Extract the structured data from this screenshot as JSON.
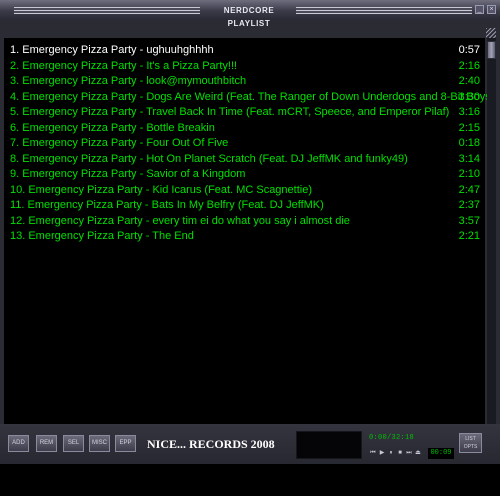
{
  "window": {
    "title": "NERDCORE PLAYLIST",
    "minimize_glyph": "_",
    "close_glyph": "×"
  },
  "tracks": [
    {
      "label": "1. Emergency Pizza Party - ughuuhghhhh",
      "duration": "0:57",
      "current": true
    },
    {
      "label": "2. Emergency Pizza Party - It's a Pizza Party!!!",
      "duration": "2:16",
      "current": false
    },
    {
      "label": "3. Emergency Pizza Party - look@mymouthbitch",
      "duration": "2:40",
      "current": false
    },
    {
      "label": "4. Emergency Pizza Party - Dogs Are Weird (Feat. The Ranger of Down Underdogs and 8-Bit Boys)",
      "duration": "3:30",
      "current": false
    },
    {
      "label": "5. Emergency Pizza Party - Travel Back In Time (Feat. mCRT, Speece, and Emperor Pilaf)",
      "duration": "3:16",
      "current": false
    },
    {
      "label": "6. Emergency Pizza Party - Bottle Breakin",
      "duration": "2:15",
      "current": false
    },
    {
      "label": "7. Emergency Pizza Party - Four Out Of Five",
      "duration": "0:18",
      "current": false
    },
    {
      "label": "8. Emergency Pizza Party - Hot On Planet Scratch (Feat. DJ JeffMK and funky49)",
      "duration": "3:14",
      "current": false
    },
    {
      "label": "9. Emergency Pizza Party - Savior of a Kingdom",
      "duration": "2:10",
      "current": false
    },
    {
      "label": "10. Emergency Pizza Party - Kid Icarus (Feat. MC Scagnettie)",
      "duration": "2:47",
      "current": false
    },
    {
      "label": "11. Emergency Pizza Party - Bats In My Belfry (Feat. DJ JeffMK)",
      "duration": "2:37",
      "current": false
    },
    {
      "label": "12. Emergency Pizza Party - every tim ei do what you say i almost die",
      "duration": "3:57",
      "current": false
    },
    {
      "label": "13. Emergency Pizza Party - The End",
      "duration": "2:21",
      "current": false
    }
  ],
  "bottom": {
    "buttons": [
      "ADD",
      "REM",
      "SEL",
      "MISC",
      "EPP"
    ],
    "brand": "NICE... RECORDS 2008",
    "time_display": "0:00/32:18",
    "mini_time": "00:09",
    "list_opts": [
      "LIST",
      "OPTS"
    ],
    "mini_controls": [
      "prev",
      "play",
      "pause",
      "stop",
      "next",
      "eject"
    ]
  },
  "colors": {
    "track_text": "#00e000",
    "current_track_text": "#ffffff",
    "playlist_bg": "#000000",
    "chrome": "#2b2b34"
  }
}
